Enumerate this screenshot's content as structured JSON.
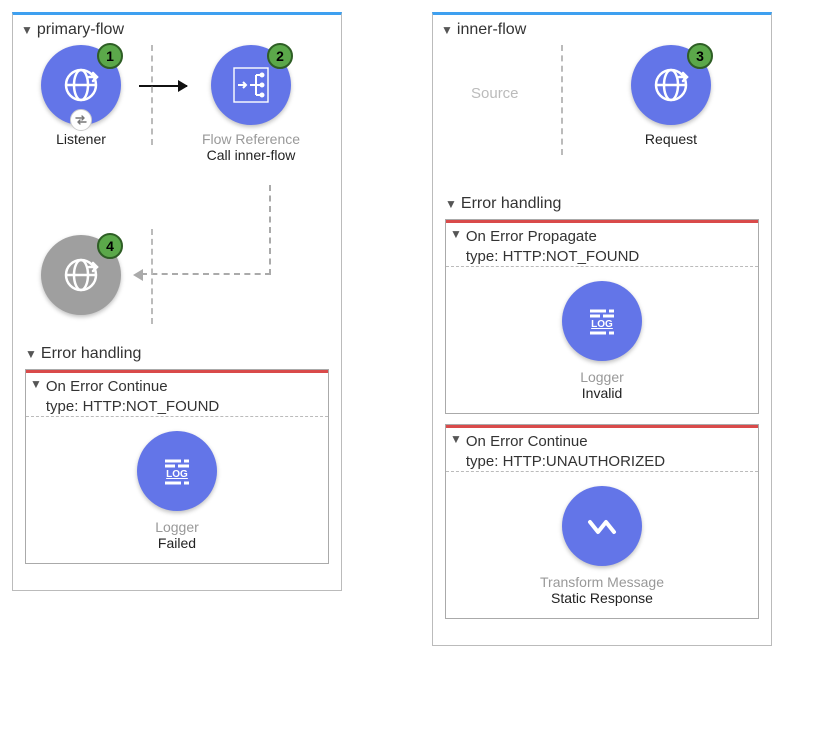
{
  "flows": {
    "primary": {
      "title": "primary-flow",
      "nodes": {
        "listener": {
          "badge": "1",
          "title": "Listener"
        },
        "flowref": {
          "badge": "2",
          "title": "Flow Reference",
          "sub": "Call inner-flow"
        },
        "greyglobe": {
          "badge": "4"
        }
      },
      "error_section_title": "Error handling",
      "errors": [
        {
          "scope_title": "On Error Continue",
          "type_line": "type: HTTP:NOT_FOUND",
          "comp_title": "Logger",
          "comp_sub": "Failed",
          "icon": "log"
        }
      ]
    },
    "inner": {
      "title": "inner-flow",
      "source_placeholder": "Source",
      "nodes": {
        "request": {
          "badge": "3",
          "title": "Request"
        }
      },
      "error_section_title": "Error handling",
      "errors": [
        {
          "scope_title": "On Error Propagate",
          "type_line": "type: HTTP:NOT_FOUND",
          "comp_title": "Logger",
          "comp_sub": "Invalid",
          "icon": "log"
        },
        {
          "scope_title": "On Error Continue",
          "type_line": "type: HTTP:UNAUTHORIZED",
          "comp_title": "Transform Message",
          "comp_sub": "Static Response",
          "icon": "transform"
        }
      ]
    }
  }
}
